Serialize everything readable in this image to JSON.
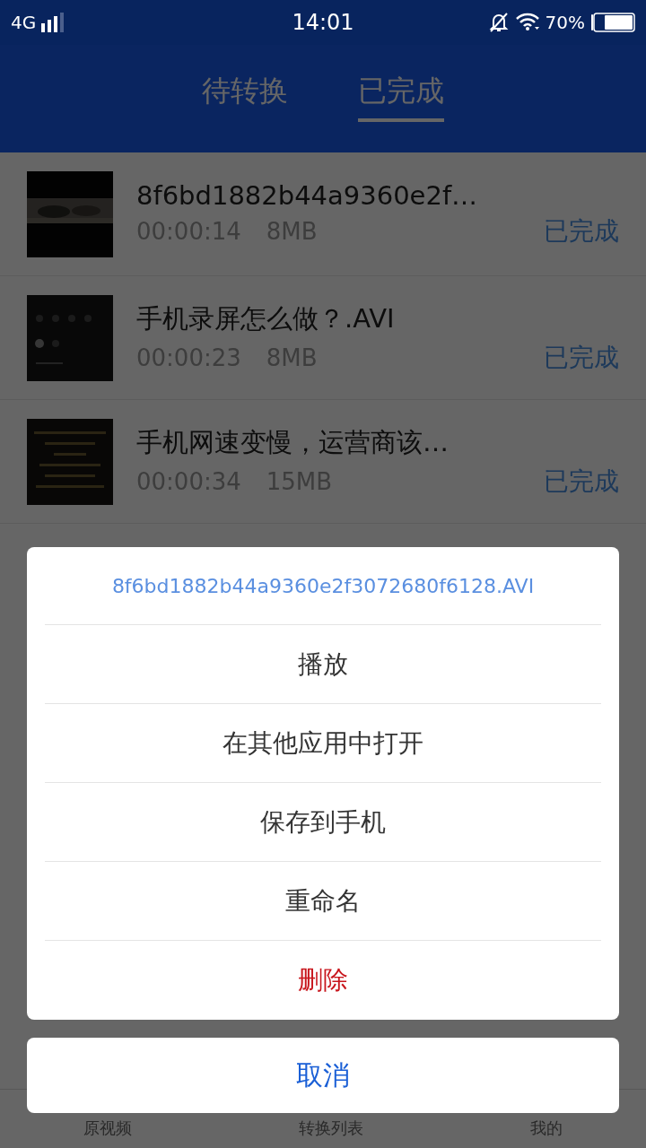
{
  "status_bar": {
    "network": "4G",
    "time": "14:01",
    "battery": "70%"
  },
  "tabs": [
    {
      "label": "待转换",
      "selected": false
    },
    {
      "label": "已完成",
      "selected": true
    }
  ],
  "files": [
    {
      "name": "8f6bd1882b44a9360e2f…",
      "duration": "00:00:14",
      "size": "8MB",
      "status": "已完成"
    },
    {
      "name": "手机录屏怎么做？.AVI",
      "duration": "00:00:23",
      "size": "8MB",
      "status": "已完成"
    },
    {
      "name": "手机网速变慢，运营商该…",
      "duration": "00:00:34",
      "size": "15MB",
      "status": "已完成"
    }
  ],
  "bottom_nav": [
    {
      "label": "原视频"
    },
    {
      "label": "转换列表"
    },
    {
      "label": "我的"
    }
  ],
  "action_sheet": {
    "title": "8f6bd1882b44a9360e2f3072680f6128.AVI",
    "actions": [
      {
        "label": "播放",
        "kind": "normal"
      },
      {
        "label": "在其他应用中打开",
        "kind": "normal"
      },
      {
        "label": "保存到手机",
        "kind": "normal"
      },
      {
        "label": "重命名",
        "kind": "normal"
      },
      {
        "label": "删除",
        "kind": "destructive"
      }
    ],
    "cancel": "取消"
  }
}
